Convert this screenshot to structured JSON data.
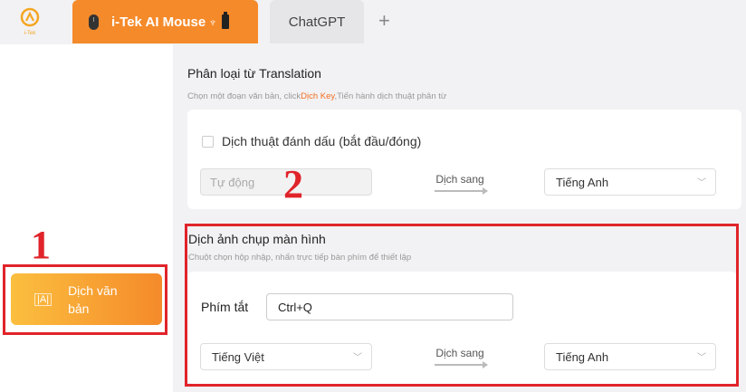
{
  "tabs": {
    "logo_text": "i-Tek",
    "active_label": "i-Tek AI Mouse",
    "usb_symbol": "♆",
    "chatgpt_label": "ChatGPT",
    "add_symbol": "+"
  },
  "sidebar": {
    "translate_text_icon": "|A|",
    "translate_text_label": "Dịch văn bản",
    "annotation_number": "1"
  },
  "word_translation": {
    "title": "Phân loại từ Translation",
    "desc_before": "Chọn một đoạn văn bản, click",
    "desc_highlight": "Dịch Key",
    "desc_after": ",Tiến hành dịch thuật phân từ",
    "mark_checkbox_label": "Dịch thuật đánh dấu (bắt đầu/đóng)",
    "mark_checked": false,
    "source_placeholder": "Tự động",
    "translate_to": "Dịch sang",
    "target_language": "Tiếng Anh",
    "annotation_number": "2"
  },
  "screenshot_translation": {
    "title": "Dịch ảnh chụp màn hình",
    "desc": "Chuột chọn hộp nhập, nhấn trực tiếp bàn phím để thiết lập",
    "shortcut_label": "Phím tắt",
    "shortcut_value": "Ctrl+Q",
    "source_language": "Tiếng Việt",
    "translate_to": "Dịch sang",
    "target_language": "Tiếng Anh"
  },
  "colors": {
    "accent_orange": "#f58a2a",
    "annotation_red": "#e0242a"
  }
}
